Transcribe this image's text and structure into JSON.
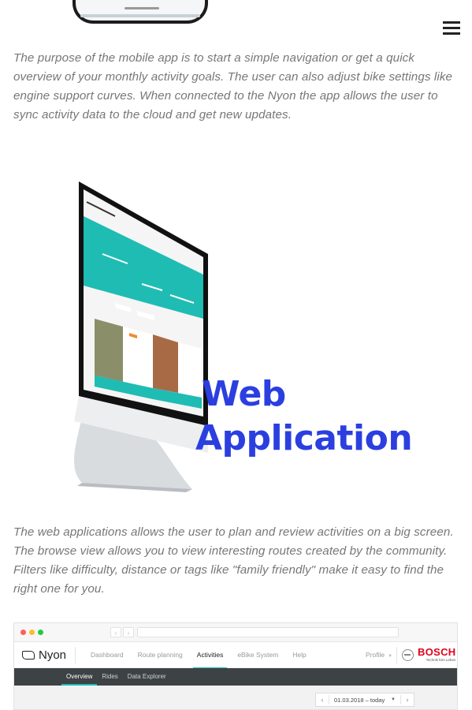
{
  "menu": {
    "icon": "hamburger-menu-icon"
  },
  "paragraphs": {
    "mobile": "The purpose of the mobile app is to start a simple navigation or get a quick overview of your monthly activity goals. The user can also adjust bike settings like engine support curves. When connected to the Nyon the app allows the user to sync activity data to the cloud and get new updates.",
    "web": "The web applications allows the user to plan and review activities on a big screen. The browse view allows you to view interesting routes created by the community. Filters like difficulty, distance or tags like \"family friendly\" make it easy to find the right one for you."
  },
  "section": {
    "title_line1": "Web",
    "title_line2": "Application"
  },
  "colors": {
    "accent_blue": "#2b3fe0",
    "teal": "#1fbcb3",
    "bosch_red": "#e2001a",
    "subnav_bg": "#3d4244"
  },
  "browser": {
    "logo_text": "Nyon",
    "nav": [
      "Dashboard",
      "Route planning",
      "Activities",
      "eBike System",
      "Help"
    ],
    "active_nav": "Activities",
    "profile_label": "Profile",
    "brand": "BOSCH",
    "brand_tagline": "Technik fürs Leben",
    "subnav": [
      "Overview",
      "Rides",
      "Data Explorer"
    ],
    "active_subnav": "Overview",
    "date_range": "01.03.2018 – today"
  }
}
